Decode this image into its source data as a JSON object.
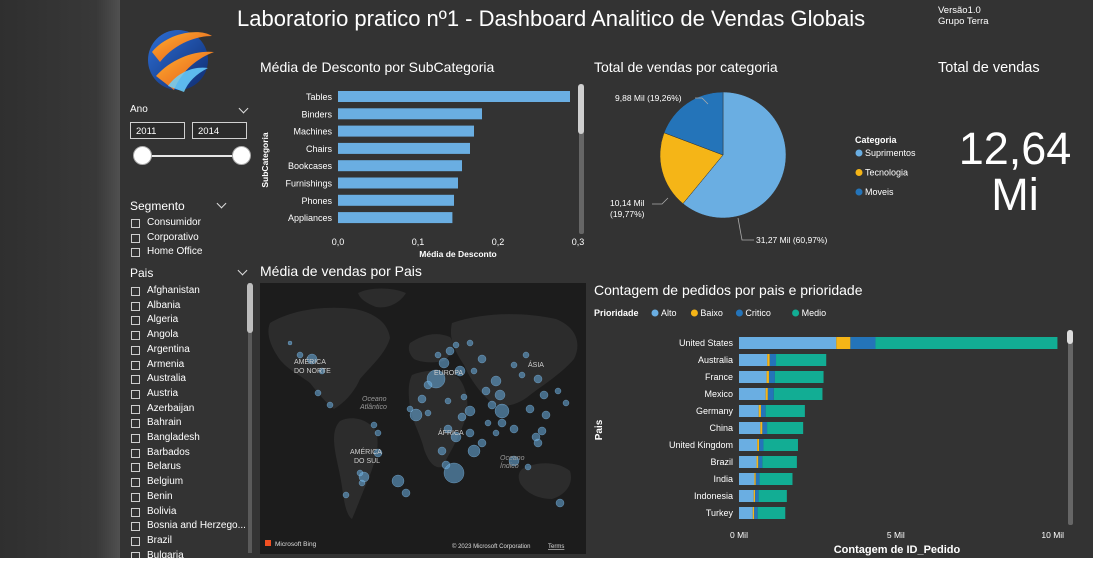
{
  "header": {
    "title": "Laboratorio pratico nº1 - Dashboard Analitico de Vendas Globais",
    "version": "Versão1.0",
    "group": "Grupo Terra"
  },
  "filters": {
    "ano_label": "Ano",
    "ano_from": "2011",
    "ano_to": "2014",
    "segmento_label": "Segmento",
    "segmentos": [
      "Consumidor",
      "Corporativo",
      "Home Office"
    ],
    "pais_label": "Pais",
    "paises": [
      "Afghanistan",
      "Albania",
      "Algeria",
      "Angola",
      "Argentina",
      "Armenia",
      "Australia",
      "Austria",
      "Azerbaijan",
      "Bahrain",
      "Bangladesh",
      "Barbados",
      "Belarus",
      "Belgium",
      "Benin",
      "Bolivia",
      "Bosnia and Herzego...",
      "Brazil",
      "Bulgaria"
    ]
  },
  "discount_chart": {
    "title": "Média de Desconto por SubCategoria",
    "ylabel": "SubCategoria",
    "xlabel": "Média de Desconto",
    "ticks": [
      "0,0",
      "0,1",
      "0,2",
      "0,3"
    ]
  },
  "pie_chart": {
    "title": "Total de vendas por categoria",
    "legend_title": "Categoria",
    "labels": [
      "9,88 Mil (19,26%)",
      "10,14 Mil",
      "(19,77%)",
      "31,27 Mil (60,97%)"
    ]
  },
  "kpi": {
    "title": "Total de vendas",
    "value_line1": "12,64",
    "value_line2": "Mi"
  },
  "map": {
    "title": "Média de vendas por Pais",
    "labels": [
      "AMÉRICA",
      "DO NORTE",
      "EUROPA",
      "ÁSIA",
      "Oceano",
      "Atlântico",
      "ÁFRICA",
      "AMÉRICA",
      "DO SUL",
      "Oceano",
      "Índico"
    ],
    "bing": "Microsoft Bing",
    "copyright": "© 2023 Microsoft Corporation",
    "terms": "Terms"
  },
  "orders_chart": {
    "title": "Contagem de pedidos por pais e prioridade",
    "legend_title": "Prioridade",
    "ylabel": "Pais",
    "xlabel": "Contagem de ID_Pedido",
    "ticks": [
      "0 Mil",
      "5 Mil",
      "10 Mil"
    ]
  },
  "chart_data": [
    {
      "type": "bar",
      "orientation": "horizontal",
      "title": "Média de Desconto por SubCategoria",
      "xlabel": "Média de Desconto",
      "ylabel": "SubCategoria",
      "categories": [
        "Tables",
        "Binders",
        "Machines",
        "Chairs",
        "Bookcases",
        "Furnishings",
        "Phones",
        "Appliances"
      ],
      "values": [
        0.29,
        0.18,
        0.17,
        0.165,
        0.155,
        0.15,
        0.145,
        0.143
      ],
      "xlim": [
        0,
        0.3
      ],
      "color": "#6aaee2"
    },
    {
      "type": "pie",
      "title": "Total de vendas por categoria",
      "legend": "Categoria",
      "slices": [
        {
          "name": "Suprimentos",
          "value": 31.27,
          "percent": 60.97,
          "color": "#6aaee2"
        },
        {
          "name": "Tecnologia",
          "value": 10.14,
          "percent": 19.77,
          "color": "#f5b517"
        },
        {
          "name": "Moveis",
          "value": 9.88,
          "percent": 19.26,
          "color": "#2474b9"
        }
      ]
    },
    {
      "type": "bar",
      "orientation": "horizontal",
      "stacked": true,
      "title": "Contagem de pedidos por pais e prioridade",
      "xlabel": "Contagem de ID_Pedido",
      "ylabel": "Pais",
      "legend": "Prioridade",
      "xlim": [
        0,
        10200
      ],
      "categories": [
        "United States",
        "Australia",
        "France",
        "Mexico",
        "Germany",
        "China",
        "United Kingdom",
        "Brazil",
        "India",
        "Indonesia",
        "Turkey"
      ],
      "series": [
        {
          "name": "Alto",
          "color": "#6aaee2",
          "values": [
            3100,
            900,
            880,
            850,
            630,
            680,
            580,
            560,
            490,
            470,
            440
          ]
        },
        {
          "name": "Baixo",
          "color": "#f5b517",
          "values": [
            450,
            80,
            75,
            70,
            70,
            65,
            60,
            55,
            45,
            45,
            45
          ]
        },
        {
          "name": "Critico",
          "color": "#2474b9",
          "values": [
            800,
            200,
            190,
            190,
            150,
            150,
            140,
            130,
            120,
            110,
            110
          ]
        },
        {
          "name": "Medio",
          "color": "#12ad94",
          "values": [
            5800,
            1600,
            1550,
            1550,
            1250,
            1150,
            1100,
            1100,
            1050,
            900,
            880
          ]
        }
      ]
    }
  ]
}
